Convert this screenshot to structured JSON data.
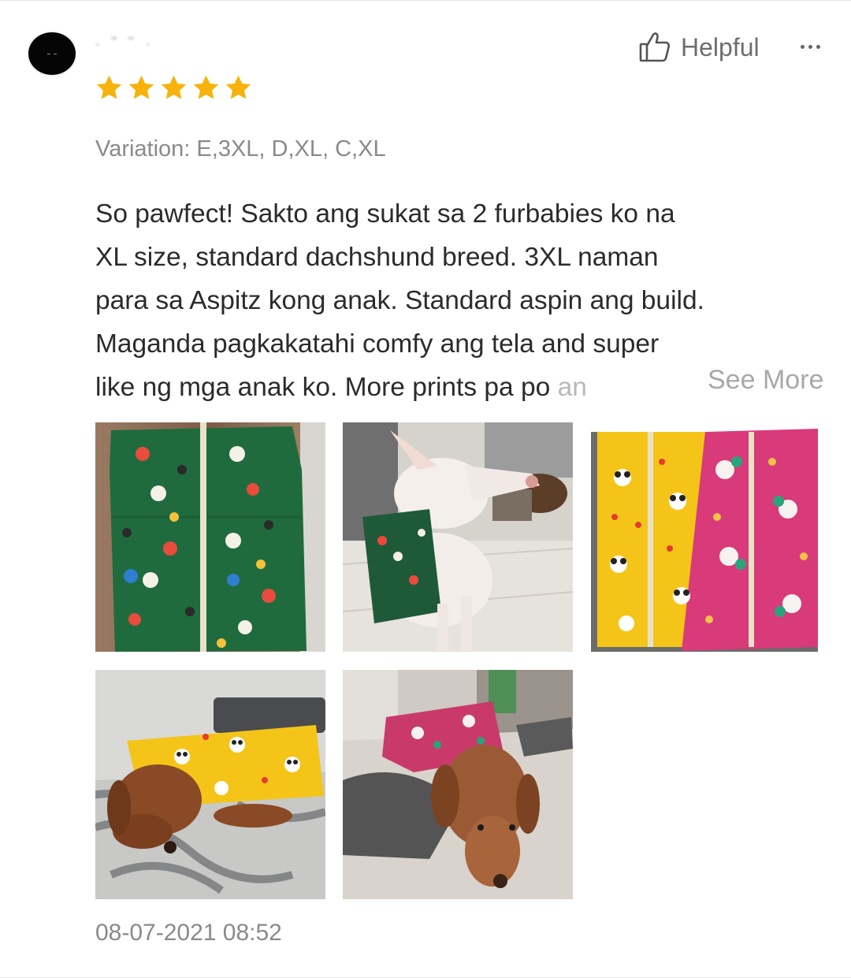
{
  "review": {
    "username": "·  ˘ ˘    ·",
    "rating": 5,
    "star_color": "#f6b30c",
    "helpful_label": "Helpful",
    "variation": "Variation: E,3XL, D,XL, C,XL",
    "text_lines": [
      "So pawfect! Sakto ang sukat sa 2 furbabies ko na",
      "XL size, standard dachshund breed. 3XL naman",
      "para sa Aspitz kong anak. Standard aspin ang build.",
      "Maganda pagkakatahi comfy ang tela and super",
      "like ng mga anak ko. More prints pa po "
    ],
    "text_faded_tail": "an",
    "see_more_label": "See More",
    "timestamp": "08-07-2021 08:52",
    "photos": [
      {
        "name": "green-cartoon-pajama-photo"
      },
      {
        "name": "white-dog-in-green-pajama-photo"
      },
      {
        "name": "yellow-and-pink-pajamas-photo"
      },
      {
        "name": "dachshund-yellow-pajama-photo"
      },
      {
        "name": "dachshund-pink-pajama-photo"
      }
    ]
  }
}
